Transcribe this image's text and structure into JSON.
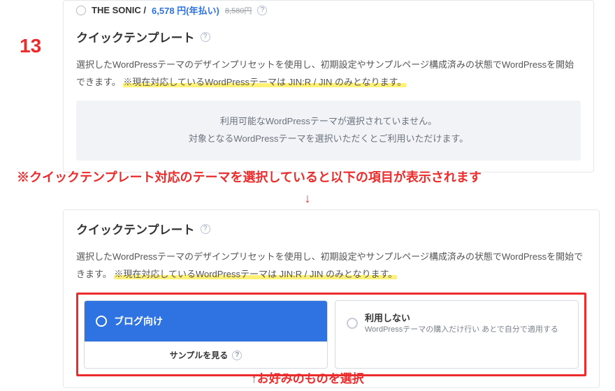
{
  "step_number": "13",
  "sonic": {
    "name": "THE SONIC /",
    "price": "6,578 円(年払い)",
    "old_price": "8,580円"
  },
  "section1": {
    "title": "クイックテンプレート",
    "desc_prefix": "選択したWordPressテーマのデザインプリセットを使用し、初期設定やサンプルページ構成済みの状態でWordPressを開始できます。",
    "highlight": "※現在対応しているWordPressテーマは JIN:R / JIN のみとなります。",
    "info_line1": "利用可能なWordPressテーマが選択されていません。",
    "info_line2": "対象となるWordPressテーマを選択いただくとご利用いただけます。"
  },
  "red_note_main": "※クイックテンプレート対応のテーマを選択していると以下の項目が表示されます",
  "red_arrow_down": "↓",
  "section2": {
    "title": "クイックテンプレート",
    "desc_prefix": "選択したWordPressテーマのデザインプリセットを使用し、初期設定やサンプルページ構成済みの状態でWordPressを開始できます。",
    "highlight": "※現在対応しているWordPressテーマは JIN:R / JIN のみとなります。",
    "option_blog": "ブログ向け",
    "sample_link": "サンプルを見る",
    "option_none_title": "利用しない",
    "option_none_sub": "WordPressテーマの購入だけ行い あとで自分で適用する"
  },
  "red_note_select": "↑お好みのものを選択",
  "q_mark": "?"
}
